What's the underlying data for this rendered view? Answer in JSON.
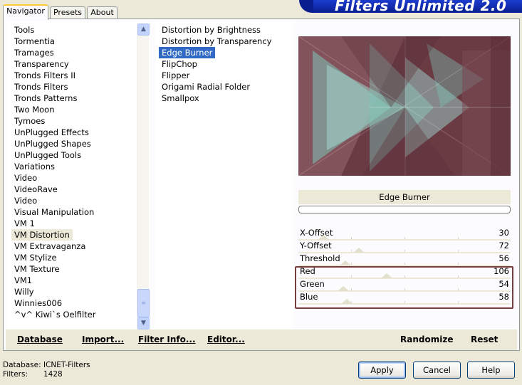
{
  "tabs": [
    "Navigator",
    "Presets",
    "About"
  ],
  "banner_title": "Filters Unlimited 2.0",
  "categories": [
    "Tools",
    "Tormentia",
    "Tramages",
    "Transparency",
    "Tronds Filters II",
    "Tronds Filters",
    "Tronds Patterns",
    "Two Moon",
    "Tymoes",
    "UnPlugged Effects",
    "UnPlugged Shapes",
    "UnPlugged Tools",
    "Variations",
    "Video",
    "VideoRave",
    "Video",
    "Visual Manipulation",
    "VM 1",
    "VM Distortion",
    "VM Extravaganza",
    "VM Stylize",
    "VM Texture",
    "VM1",
    "Willy",
    "Winnies006",
    "^v^ Kiwi`s Oelfilter"
  ],
  "selected_category": "VM Distortion",
  "filters": [
    "Distortion by Brightness",
    "Distortion by Transparency",
    "Edge Burner",
    "FlipChop",
    "Flipper",
    "Origami Radial Folder",
    "Smallpox"
  ],
  "selected_filter": "Edge Burner",
  "filter_name": "Edge Burner",
  "params": [
    {
      "label": "X-Offset",
      "value": "30"
    },
    {
      "label": "Y-Offset",
      "value": "72"
    },
    {
      "label": "Threshold",
      "value": "56"
    },
    {
      "label": "Red",
      "value": "106"
    },
    {
      "label": "Green",
      "value": "54"
    },
    {
      "label": "Blue",
      "value": "58"
    }
  ],
  "bottom_links": {
    "database": "Database",
    "import": "Import...",
    "filter_info": "Filter Info...",
    "editor": "Editor...",
    "randomize": "Randomize",
    "reset": "Reset"
  },
  "status": {
    "database_label": "Database:",
    "database_value": "ICNET-Filters",
    "filters_label": "Filters:",
    "filters_value": "1428"
  },
  "buttons": {
    "apply": "Apply",
    "cancel": "Cancel",
    "help": "Help"
  },
  "colors": {
    "selection": "#316ac5",
    "highlight_box": "#7a3c3c",
    "preview_base": "#6a3a43",
    "preview_accent": "#7ec5b8"
  }
}
